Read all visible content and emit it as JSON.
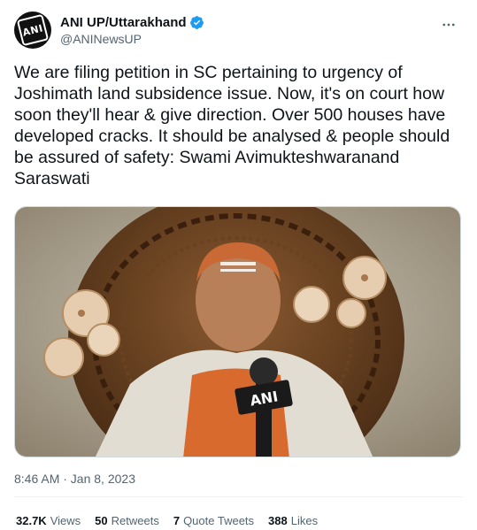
{
  "author": {
    "display_name": "ANI UP/Uttarakhand",
    "handle": "@ANINewsUP",
    "avatar_text": "ANI",
    "verified_color": "#1d9bf0"
  },
  "tweet": {
    "text": "We are filing petition in SC pertaining to urgency of Joshimath land subsidence issue. Now, it's on court how soon they'll hear & give direction. Over 500 houses have developed cracks. It should be analysed & people should be assured of safety: Swami Avimukteshwaranand Saraswati",
    "media_mic_label": "ANI",
    "timestamp": "8:46 AM · Jan 8, 2023"
  },
  "stats": {
    "views_count": "32.7K",
    "views_label": "Views",
    "retweets_count": "50",
    "retweets_label": "Retweets",
    "quotes_count": "7",
    "quotes_label": "Quote Tweets",
    "likes_count": "388",
    "likes_label": "Likes"
  },
  "icons": {
    "more": "more-horizontal-icon",
    "verified": "verified-badge-icon"
  }
}
